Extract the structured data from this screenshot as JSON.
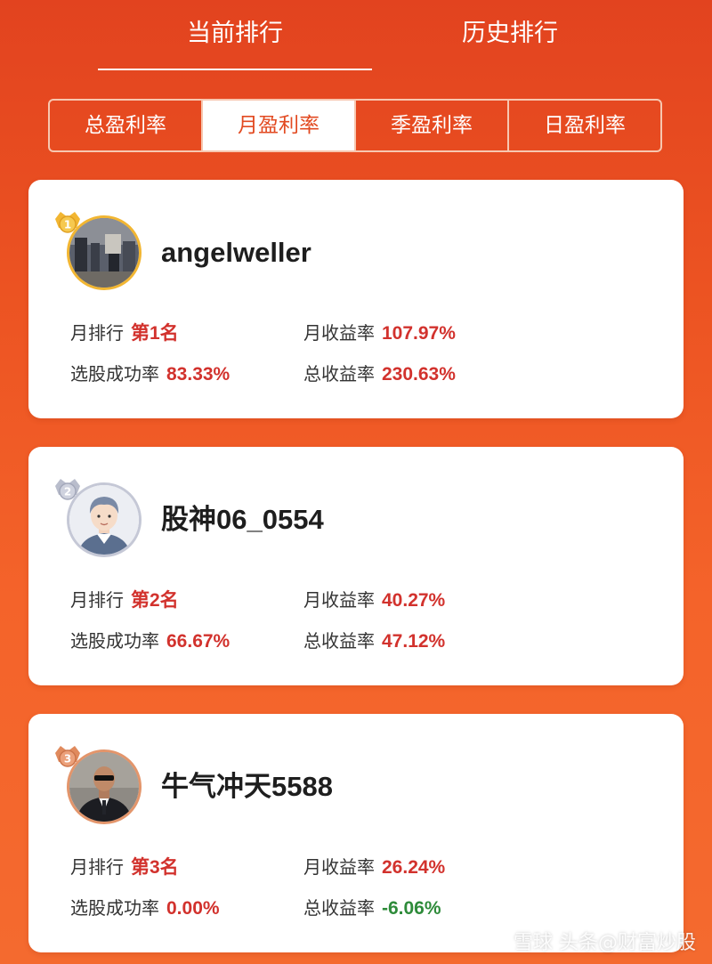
{
  "top_tabs": {
    "current": "当前排行",
    "history": "历史排行"
  },
  "segments": [
    "总盈利率",
    "月盈利率",
    "季盈利率",
    "日盈利率"
  ],
  "labels": {
    "month_rank": "月排行",
    "month_return": "月收益率",
    "success_rate": "选股成功率",
    "total_return": "总收益率"
  },
  "entries": [
    {
      "username": "angelweller",
      "rank": "第1名",
      "month_return": "107.97%",
      "success_rate": "83.33%",
      "total_return": "230.63%"
    },
    {
      "username": "股神06_0554",
      "rank": "第2名",
      "month_return": "40.27%",
      "success_rate": "66.67%",
      "total_return": "47.12%"
    },
    {
      "username": "牛气冲天5588",
      "rank": "第3名",
      "month_return": "26.24%",
      "success_rate": "0.00%",
      "total_return": "-6.06%"
    }
  ],
  "watermark": "雪球 头条@财富炒股",
  "colors": {
    "accent": "#e24a21",
    "positive": "#d2322d",
    "negative": "#2e8b3a",
    "gold": "#f2b632",
    "silver": "#c5c8d6",
    "bronze": "#e3956b"
  },
  "icons": {
    "medal_1": "gold-crown-medal-icon",
    "medal_2": "silver-crown-medal-icon",
    "medal_3": "bronze-crown-medal-icon"
  }
}
